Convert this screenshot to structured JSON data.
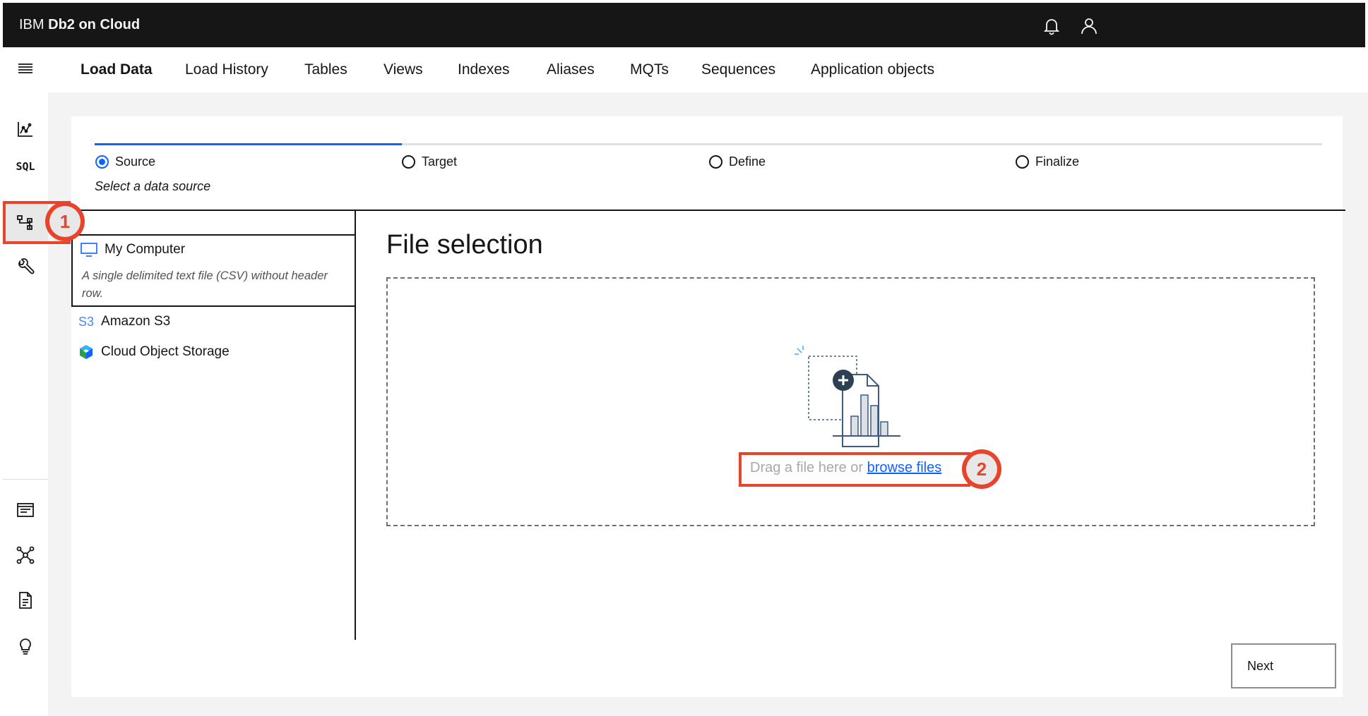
{
  "header": {
    "brand_prefix": "IBM",
    "brand_product": "Db2 on Cloud",
    "icons": [
      "notification-icon",
      "user-icon"
    ]
  },
  "rail": {
    "menu_icon": "menu-icon",
    "items": [
      {
        "name": "monitor-icon"
      },
      {
        "name": "sql-icon",
        "label": "SQL"
      },
      {
        "name": "data-icon"
      },
      {
        "name": "administration-icon"
      }
    ],
    "bottom_items": [
      {
        "name": "console-icon"
      },
      {
        "name": "connections-icon"
      },
      {
        "name": "document-icon"
      },
      {
        "name": "lightbulb-icon"
      }
    ]
  },
  "tabs": [
    {
      "label": "Load Data",
      "active": true
    },
    {
      "label": "Load History"
    },
    {
      "label": "Tables"
    },
    {
      "label": "Views"
    },
    {
      "label": "Indexes"
    },
    {
      "label": "Aliases"
    },
    {
      "label": "MQTs"
    },
    {
      "label": "Sequences"
    },
    {
      "label": "Application objects"
    }
  ],
  "progress": {
    "steps": [
      {
        "label": "Source",
        "selected": true
      },
      {
        "label": "Target"
      },
      {
        "label": "Define"
      },
      {
        "label": "Finalize"
      }
    ],
    "subtitle": "Select a data source",
    "fraction_complete": 0.25,
    "accent_color": "#0f62fe"
  },
  "sources": {
    "items": [
      {
        "label": "My Computer",
        "icon": "monitor-screen-icon",
        "description": "A single delimited text file (CSV) without header row."
      },
      {
        "label": "Amazon S3",
        "icon_text": "S3"
      },
      {
        "label": "Cloud Object Storage",
        "icon": "cube-icon"
      }
    ]
  },
  "file_selection": {
    "title": "File selection",
    "drop_text": "Drag a file here or ",
    "browse_link": "browse files"
  },
  "callouts": {
    "first": "1",
    "second": "2",
    "color": "#e8442c"
  },
  "footer": {
    "next_label": "Next"
  }
}
